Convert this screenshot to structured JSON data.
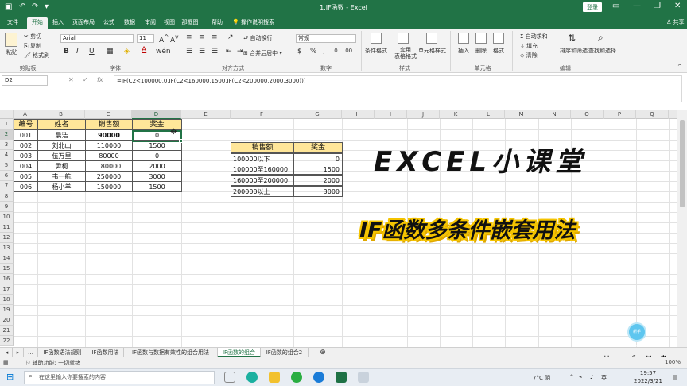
{
  "titlebar": {
    "title": "1.IF函数 - Excel",
    "login": "登录",
    "qa_icons": [
      "save-icon",
      "undo-icon",
      "redo-icon",
      "customize-icon"
    ]
  },
  "tabs": [
    "文件",
    "开始",
    "插入",
    "页面布局",
    "公式",
    "数据",
    "审阅",
    "视图",
    "帮助"
  ],
  "active_tab": "开始",
  "tell_me": "操作说明搜索",
  "share": "共享",
  "ribbon": {
    "clipboard": {
      "paste": "粘贴",
      "cut": "剪切",
      "copy": "复制",
      "format_painter": "格式刷",
      "group": "剪贴板"
    },
    "font": {
      "name": "Arial",
      "size": "11",
      "bold": "B",
      "italic": "I",
      "underline": "U",
      "group": "字体"
    },
    "alignment": {
      "wrap": "自动换行",
      "merge": "合并后居中",
      "group": "对齐方式"
    },
    "number": {
      "format": "常规",
      "group": "数字"
    },
    "styles": {
      "conditional": "条件格式",
      "table": "套用\n表格格式",
      "cell_styles": "单元格样式",
      "group": "样式"
    },
    "cells": {
      "insert": "插入",
      "delete": "删除",
      "format": "格式",
      "group": "单元格"
    },
    "editing": {
      "autosum": "自动求和",
      "fill": "填充",
      "clear": "清除",
      "sort": "排序和筛选",
      "find": "查找和选择",
      "group": "编辑"
    }
  },
  "formula_bar": {
    "name_box": "D2",
    "formula": "=IF(C2<100000,0,IF(C2<160000,1500,IF(C2<200000,2000,3000)))"
  },
  "columns": [
    "A",
    "B",
    "C",
    "D",
    "E",
    "F",
    "G",
    "H",
    "I",
    "J",
    "K",
    "L",
    "M",
    "N",
    "O",
    "P",
    "Q"
  ],
  "rows": [
    "1",
    "2",
    "3",
    "4",
    "5",
    "6",
    "7",
    "8",
    "9",
    "10",
    "11",
    "12",
    "13",
    "14",
    "15",
    "16",
    "17",
    "18",
    "19",
    "20",
    "21",
    "22"
  ],
  "selected_cell": {
    "col": "D",
    "row": "2"
  },
  "table1": {
    "headers": [
      "编号",
      "姓名",
      "销售额",
      "奖金"
    ],
    "rows": [
      [
        "001",
        "晨浩",
        "90000",
        "0"
      ],
      [
        "002",
        "刘北山",
        "110000",
        "1500"
      ],
      [
        "003",
        "伍万里",
        "80000",
        "0"
      ],
      [
        "004",
        "尹柯",
        "180000",
        "2000"
      ],
      [
        "005",
        "韦一航",
        "250000",
        "3000"
      ],
      [
        "006",
        "杨小羊",
        "150000",
        "1500"
      ]
    ]
  },
  "table2": {
    "headers": [
      "销售额",
      "奖金"
    ],
    "rows": [
      [
        "100000以下",
        "0"
      ],
      [
        "100000至160000",
        "1500"
      ],
      [
        "160000至200000",
        "2000"
      ],
      [
        "200000以上",
        "3000"
      ]
    ]
  },
  "overlay": {
    "title1": "EXCEL小课堂",
    "title2": "IF函数多条件嵌套用法",
    "badge": "新手EXCEL"
  },
  "sheet_tabs": [
    "IF函数语法规则",
    "IF函数用法",
    "IF函数与数据有效性的组合用法",
    "IF函数的组合",
    "IF函数的组合2"
  ],
  "active_sheet": "IF函数的组合",
  "ime": {
    "lang": "英",
    "punct": "·,",
    "moon": "☾",
    "simp": "简",
    "gear": "⚙"
  },
  "status": {
    "ready": "辅助功能: 一切就绪",
    "zoom": "100%"
  },
  "taskbar": {
    "search_placeholder": "在这里输入你要搜索的内容",
    "weather": "7°C 阴",
    "lang": "英",
    "time": "19:57",
    "date": "2022/3/21",
    "apps": [
      "task-view-icon",
      "edge-icon",
      "explorer-icon",
      "wechat-icon",
      "edge-browser-icon",
      "excel-icon",
      "app-icon"
    ]
  }
}
